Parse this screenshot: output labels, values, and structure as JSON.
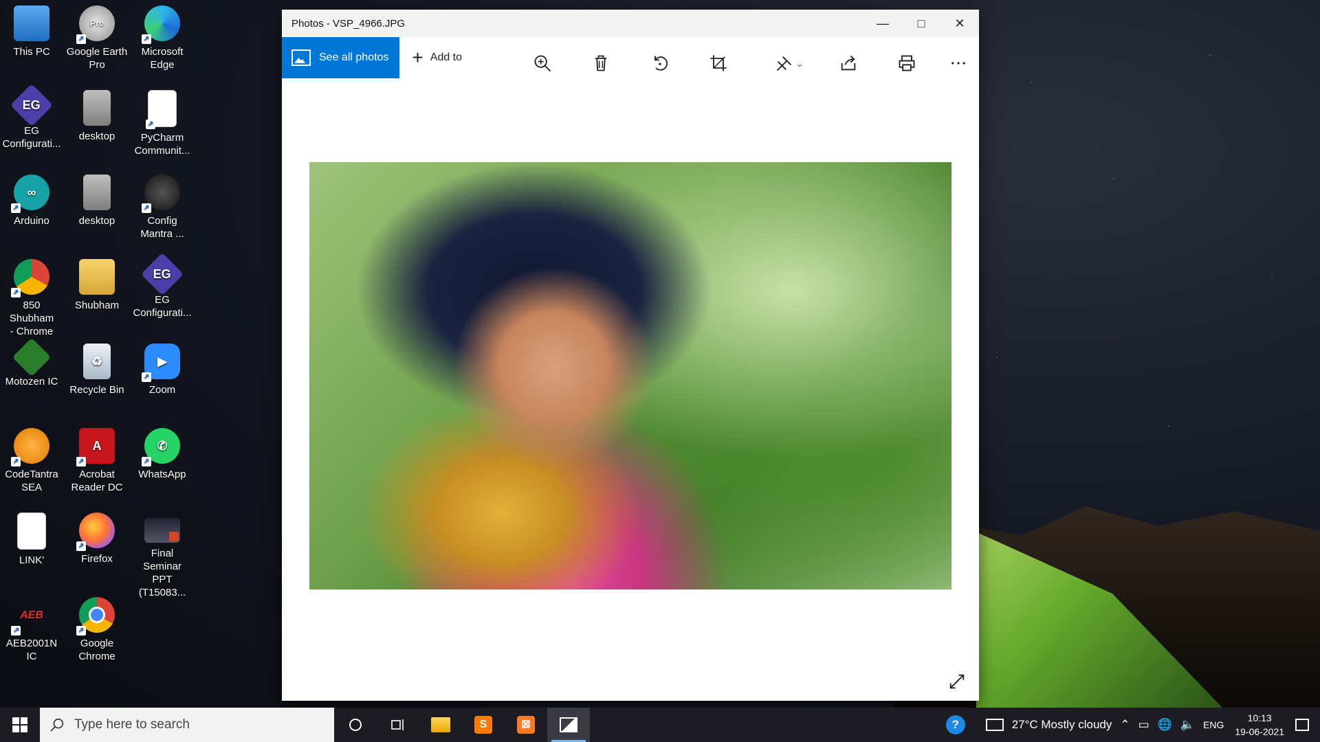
{
  "desktop": {
    "icons": [
      {
        "label_line1": "This PC",
        "label_line2": ""
      },
      {
        "label_line1": "Google Earth",
        "label_line2": "Pro",
        "badge": "Pro"
      },
      {
        "label_line1": "Microsoft",
        "label_line2": "Edge"
      },
      {
        "label_line1": "EG",
        "label_line2": "Configurati...",
        "logo": "EG"
      },
      {
        "label_line1": "desktop",
        "label_line2": ""
      },
      {
        "label_line1": "PyCharm",
        "label_line2": "Communit..."
      },
      {
        "label_line1": "Arduino",
        "label_line2": ""
      },
      {
        "label_line1": "desktop",
        "label_line2": ""
      },
      {
        "label_line1": "Config",
        "label_line2": "Mantra ..."
      },
      {
        "label_line1": "850 Shubham",
        "label_line2": "- Chrome"
      },
      {
        "label_line1": "Shubham",
        "label_line2": ""
      },
      {
        "label_line1": "EG",
        "label_line2": "Configurati...",
        "logo": "EG"
      },
      {
        "label_line1": "Motozen IC",
        "label_line2": ""
      },
      {
        "label_line1": "Recycle Bin",
        "label_line2": ""
      },
      {
        "label_line1": "Zoom",
        "label_line2": ""
      },
      {
        "label_line1": "CodeTantra",
        "label_line2": "SEA"
      },
      {
        "label_line1": "Acrobat",
        "label_line2": "Reader DC"
      },
      {
        "label_line1": "WhatsApp",
        "label_line2": ""
      },
      {
        "label_line1": "LINK'",
        "label_line2": ""
      },
      {
        "label_line1": "Firefox",
        "label_line2": ""
      },
      {
        "label_line1": "Final Seminar",
        "label_line2": "PPT (T15083..."
      },
      {
        "label_line1": "AEB2001N IC",
        "label_line2": "",
        "logo": "AEB"
      },
      {
        "label_line1": "Google",
        "label_line2": "Chrome"
      }
    ]
  },
  "window": {
    "title": "Photos - VSP_4966.JPG",
    "see_all_label": "See all photos",
    "add_to_label": "Add to"
  },
  "taskbar": {
    "search_placeholder": "Type here to search",
    "weather": "27°C  Mostly cloudy",
    "language": "ENG",
    "time": "10:13",
    "date": "19-06-2021"
  },
  "colors": {
    "accent": "#0078d7",
    "taskbar": "#1c1c22"
  }
}
